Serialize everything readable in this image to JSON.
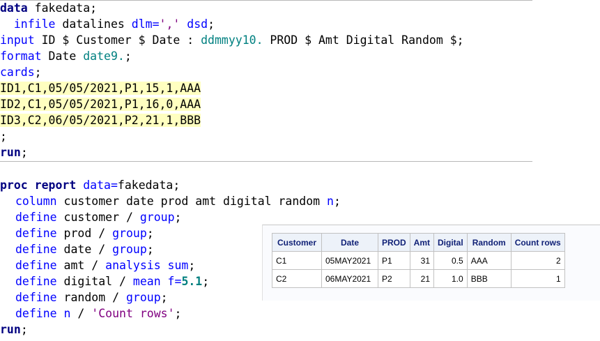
{
  "code": {
    "data_kw": "data",
    "data_name": " fakedata;",
    "infile_indent": "  ",
    "infile_kw": "infile",
    "infile_mid": " datalines ",
    "infile_opt": "dlm=",
    "infile_q": "','",
    "infile_dsd": " dsd",
    "infile_end": ";",
    "input_kw": "input",
    "input_vars1": " ID $ Customer $ Date : ",
    "input_fmt": "ddmmyy10.",
    "input_vars2": " PROD $ Amt Digital Random $;",
    "format_kw": "format",
    "format_var": " Date ",
    "format_fmt": "date9.",
    "format_end": ";",
    "cards_kw": "cards",
    "cards_end": ";",
    "datalines": [
      "ID1,C1,05/05/2021,P1,15,1,AAA",
      "ID2,C1,05/05/2021,P1,16,0,AAA",
      "ID3,C2,06/05/2021,P2,21,1,BBB"
    ],
    "semicolon": ";",
    "run1": "run",
    "run1_end": ";",
    "proc_kw": "proc report",
    "proc_sp": " ",
    "proc_opt": "data=",
    "proc_name": "fakedata;",
    "column_kw": "column",
    "column_vars": " customer date prod amt digital random ",
    "column_n": "n",
    "column_end": ";",
    "define_kw": "define",
    "def_customer_var": " customer / ",
    "def_customer_opt": "group",
    "def_customer_end": ";",
    "def_prod_var": " prod / ",
    "def_prod_opt": "group",
    "def_prod_end": ";",
    "def_date_var": " date / ",
    "def_date_opt": "group",
    "def_date_end": ";",
    "def_amt_var": " amt / ",
    "def_amt_opt": "analysis sum",
    "def_amt_end": ";",
    "def_digital_var": " digital / ",
    "def_digital_opt": "mean f=",
    "def_digital_num": "5.1",
    "def_digital_end": ";",
    "def_random_var": " random / ",
    "def_random_opt": "group",
    "def_random_end": ";",
    "def_n_var": " ",
    "def_n_opt": "n",
    "def_n_mid": " / ",
    "def_n_str": "'Count rows'",
    "def_n_end": ";",
    "run2": "run",
    "run2_end": ";"
  },
  "report": {
    "headers": [
      "Customer",
      "Date",
      "PROD",
      "Amt",
      "Digital",
      "Random",
      "Count rows"
    ],
    "rows": [
      [
        "C1",
        "05MAY2021",
        "P1",
        "31",
        "0.5",
        "AAA",
        "2"
      ],
      [
        "C2",
        "06MAY2021",
        "P2",
        "21",
        "1.0",
        "BBB",
        "1"
      ]
    ]
  }
}
